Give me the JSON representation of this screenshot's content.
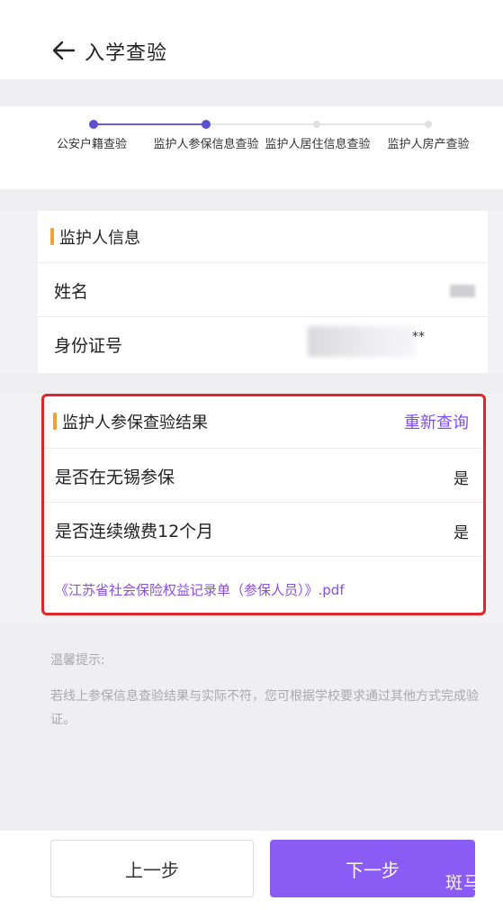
{
  "header": {
    "title": "入学查验"
  },
  "steps": [
    {
      "label": "公安户籍查验",
      "state": "done"
    },
    {
      "label": "监护人参保信息查验",
      "state": "current"
    },
    {
      "label": "监护人居住信息查验",
      "state": "pending"
    },
    {
      "label": "监护人房产查验",
      "state": "pending"
    }
  ],
  "guardian": {
    "section_title": "监护人信息",
    "name_label": "姓名",
    "id_label": "身份证号",
    "id_suffix": "**"
  },
  "result": {
    "section_title": "监护人参保查验结果",
    "requery_label": "重新查询",
    "rows": [
      {
        "label": "是否在无锡参保",
        "value": "是"
      },
      {
        "label": "是否连续缴费12个月",
        "value": "是"
      }
    ],
    "pdf_link": "《江苏省社会保险权益记录单（参保人员）》.pdf"
  },
  "tips": {
    "title": "温馨提示:",
    "text": "若线上参保信息查验结果与实际不符，您可根据学校要求通过其他方式完成验证。"
  },
  "footer": {
    "prev_label": "上一步",
    "next_label": "下一步",
    "watermark": "斑马号"
  },
  "colors": {
    "accent_purple": "#7c4dff",
    "button_purple": "#8a5cf5",
    "accent_orange": "#f0a236",
    "highlight_red": "#e0262b"
  }
}
